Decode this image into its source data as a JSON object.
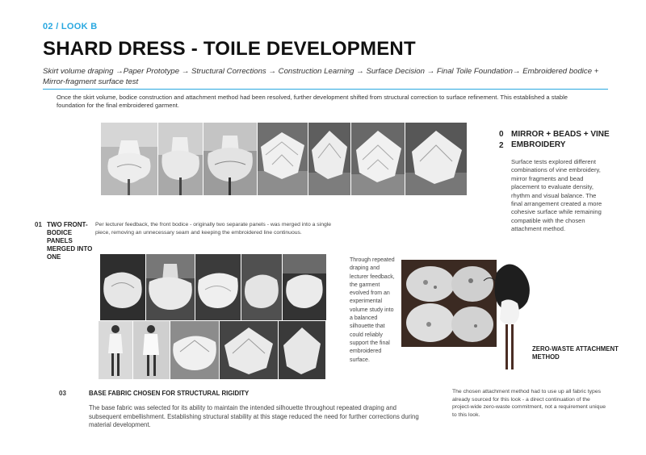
{
  "header": {
    "section_tag": "02 / LOOK B",
    "title": "SHARD DRESS - TOILE DEVELOPMENT",
    "subtitle": "Skirt volume draping →Paper Prototype → Structural Corrections → Construction Learning → Surface Decision → Final Toile Foundation→ Embroidered bodice + Mirror-fragment surface test"
  },
  "intro": "Once the skirt volume, bodice construction and attachment method had been resolved, further development shifted from structural correction to surface refinement. This established a stable foundation for the final embroidered garment.",
  "section_02": {
    "number_line1": "0",
    "number_line2": "2",
    "heading": "MIRROR + BEADS + VINE EMBROIDERY",
    "body": "Surface tests explored different combinations of vine embroidery, mirror fragments and bead placement to evaluate density, rhythm and visual balance. The final arrangement created a more cohesive surface while remaining compatible with the chosen attachment method."
  },
  "section_01": {
    "number": "01",
    "heading": "TWO FRONT-BODICE PANELS MERGED INTO ONE",
    "body": "Per lecturer feedback, the front bodice - originally two separate panels - was merged into a single piece, removing an unnecessary seam and keeping the embroidered line continuous."
  },
  "draping_note": "Through repeated draping and lecturer feedback, the garment evolved from an experimental volume study into a balanced silhouette that could reliably support the final embroidered surface.",
  "zero_waste": {
    "heading": "ZERO-WASTE ATTACHMENT METHOD",
    "body": "The chosen attachment method had to use up all fabric types already sourced for this look - a direct continuation of the project-wide zero-waste commitment, not a requirement unique to this look."
  },
  "section_03": {
    "number": "03",
    "heading": "BASE FABRIC CHOSEN FOR STRUCTURAL RIGIDITY",
    "body": "The base fabric was selected for its ability to maintain the intended silhouette throughout repeated draping and subsequent embellishment. Establishing structural stability at this stage reduced the need for further corrections during material development."
  },
  "colors": {
    "accent": "#29a8e0",
    "text": "#333333",
    "photo_dark": "#2b2b2b",
    "photo_light": "#e6e6e6"
  }
}
